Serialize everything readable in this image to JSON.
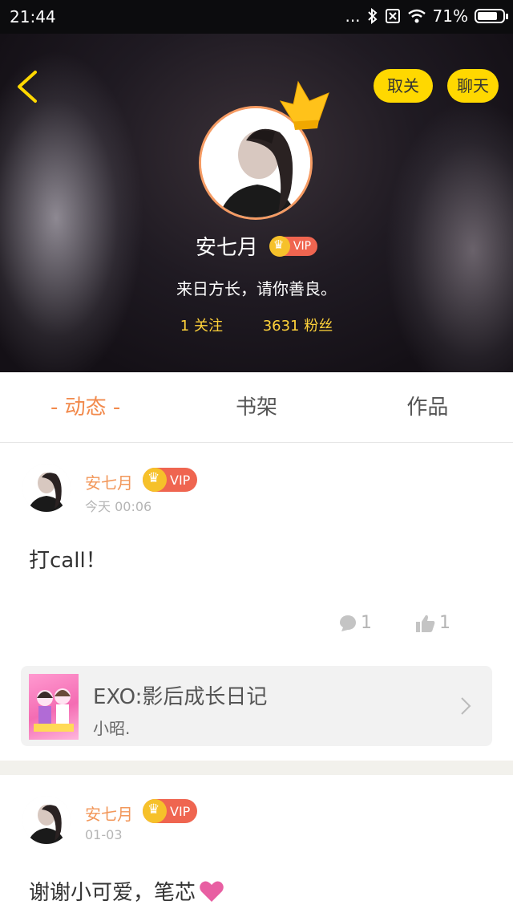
{
  "status_bar": {
    "time": "21:44",
    "dots": "...",
    "battery": "71%"
  },
  "header": {
    "unfollow_label": "取关",
    "chat_label": "聊天",
    "user_name": "安七月",
    "vip_label": "VIP",
    "bio": "来日方长，请你善良。",
    "following": "1 关注",
    "fans": "3631 粉丝"
  },
  "tabs": [
    {
      "label": "- 动态 -",
      "active": true
    },
    {
      "label": "书架",
      "active": false
    },
    {
      "label": "作品",
      "active": false
    }
  ],
  "posts": [
    {
      "author": "安七月",
      "vip_label": "VIP",
      "time": "今天 00:06",
      "text": "打call！",
      "comments": "1",
      "likes": "1",
      "book": {
        "title": "EXO:影后成长日记",
        "author": "小昭."
      }
    },
    {
      "author": "安七月",
      "vip_label": "VIP",
      "time": "01-03",
      "text": "谢谢小可爱，笔芯"
    }
  ],
  "colors": {
    "accent": "#f28a4c",
    "yellow": "#ffd800",
    "vip_red": "#ef6550",
    "gold": "#f6c12a"
  }
}
